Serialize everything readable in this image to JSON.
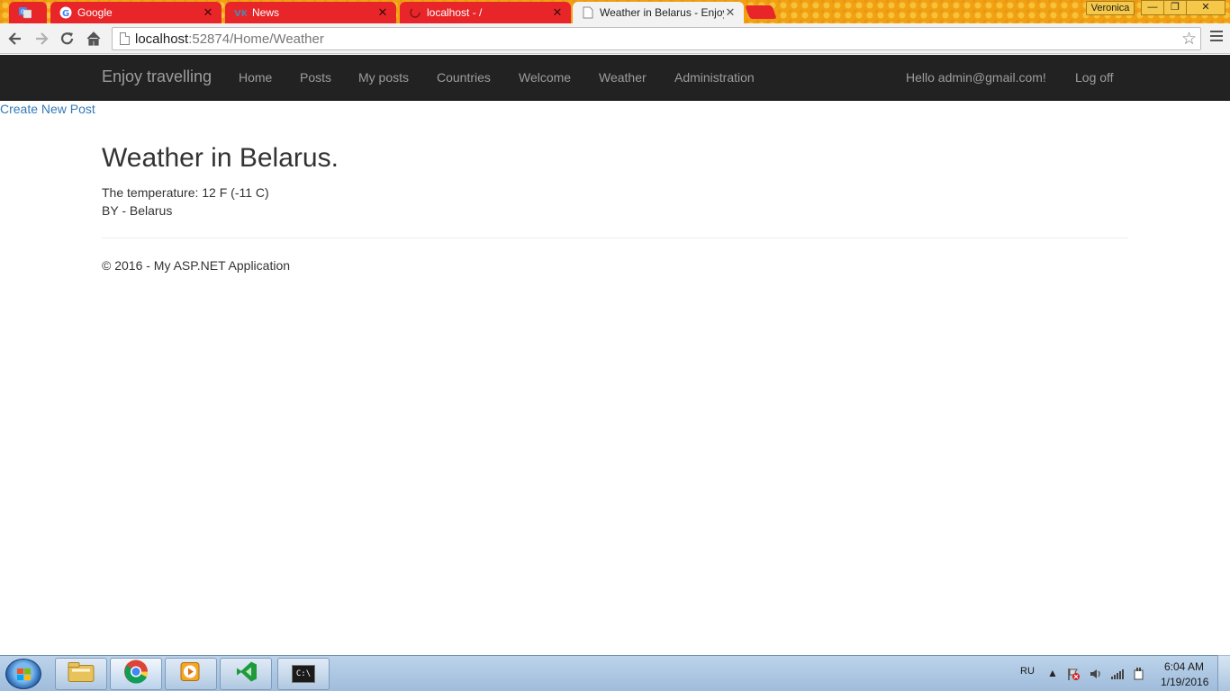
{
  "browser": {
    "tabs": [
      {
        "title": "",
        "icon": "google-translate-icon"
      },
      {
        "title": "Google",
        "icon": "google-icon"
      },
      {
        "title": "News",
        "icon": "vk-icon"
      },
      {
        "title": "localhost - /",
        "icon": "loading-icon"
      },
      {
        "title": "Weather in Belarus - Enjoy",
        "icon": "page-icon"
      }
    ],
    "profile_name": "Veronica",
    "address_host": "localhost",
    "address_rest": ":52874/Home/Weather"
  },
  "site": {
    "brand": "Enjoy travelling",
    "nav": [
      "Home",
      "Posts",
      "My posts",
      "Countries",
      "Welcome",
      "Weather",
      "Administration"
    ],
    "greeting": "Hello admin@gmail.com!",
    "logoff": "Log off"
  },
  "page": {
    "create_link": "Create New Post",
    "title": "Weather in Belarus.",
    "temperature": "The temperature: 12 F (-11 C)",
    "country": "BY - Belarus",
    "footer": "© 2016 - My ASP.NET Application"
  },
  "taskbar": {
    "apps": [
      "file-explorer-icon",
      "chrome-icon",
      "media-player-icon",
      "visual-studio-icon",
      "command-prompt-icon"
    ],
    "language": "RU",
    "cmd_label": "C:\\",
    "time": "6:04 AM",
    "date": "1/19/2016"
  },
  "colors": {
    "navbar": "#222222",
    "nav_text": "#9d9d9d",
    "link": "#337ab7",
    "tab_inactive": "#e8262a",
    "tab_active": "#f2f2f2"
  }
}
